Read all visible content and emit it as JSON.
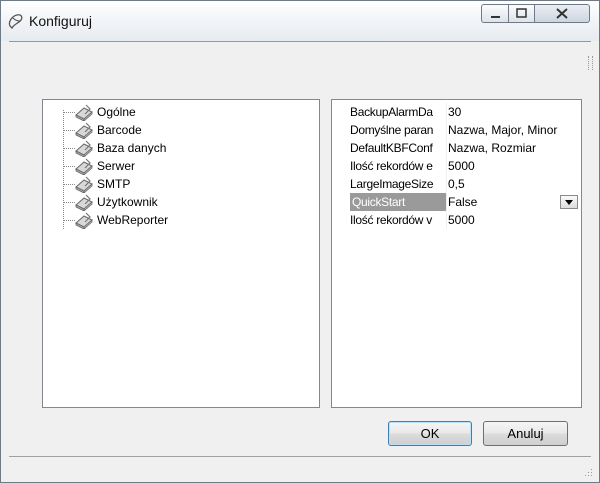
{
  "window": {
    "title": "Konfiguruj",
    "title_icon": "konfig-app-icon",
    "controls": {
      "minimize": "minimize-icon",
      "maximize": "maximize-icon",
      "close": "close-icon"
    }
  },
  "tree": {
    "items": [
      {
        "label": "Ogólne",
        "icon": "gear-node-icon"
      },
      {
        "label": "Barcode",
        "icon": "gear-node-icon"
      },
      {
        "label": "Baza danych",
        "icon": "gear-node-icon"
      },
      {
        "label": "Serwer",
        "icon": "gear-node-icon"
      },
      {
        "label": "SMTP",
        "icon": "gear-node-icon"
      },
      {
        "label": "Użytkownik",
        "icon": "gear-node-icon"
      },
      {
        "label": "WebReporter",
        "icon": "gear-node-icon"
      }
    ]
  },
  "properties": {
    "rows": [
      {
        "name": "BackupAlarmDa",
        "value": "30"
      },
      {
        "name": "Domyślne paran",
        "value": "Nazwa, Major, Minor"
      },
      {
        "name": "DefaultKBFConf",
        "value": "Nazwa, Rozmiar"
      },
      {
        "name": "Ilość rekordów e",
        "value": "5000"
      },
      {
        "name": "LargeImageSize",
        "value": "0,5"
      },
      {
        "name": "QuickStart",
        "value": "False",
        "selected": true
      },
      {
        "name": "Ilość rekordów v",
        "value": "5000"
      }
    ]
  },
  "buttons": {
    "ok": "OK",
    "cancel": "Anuluj"
  }
}
